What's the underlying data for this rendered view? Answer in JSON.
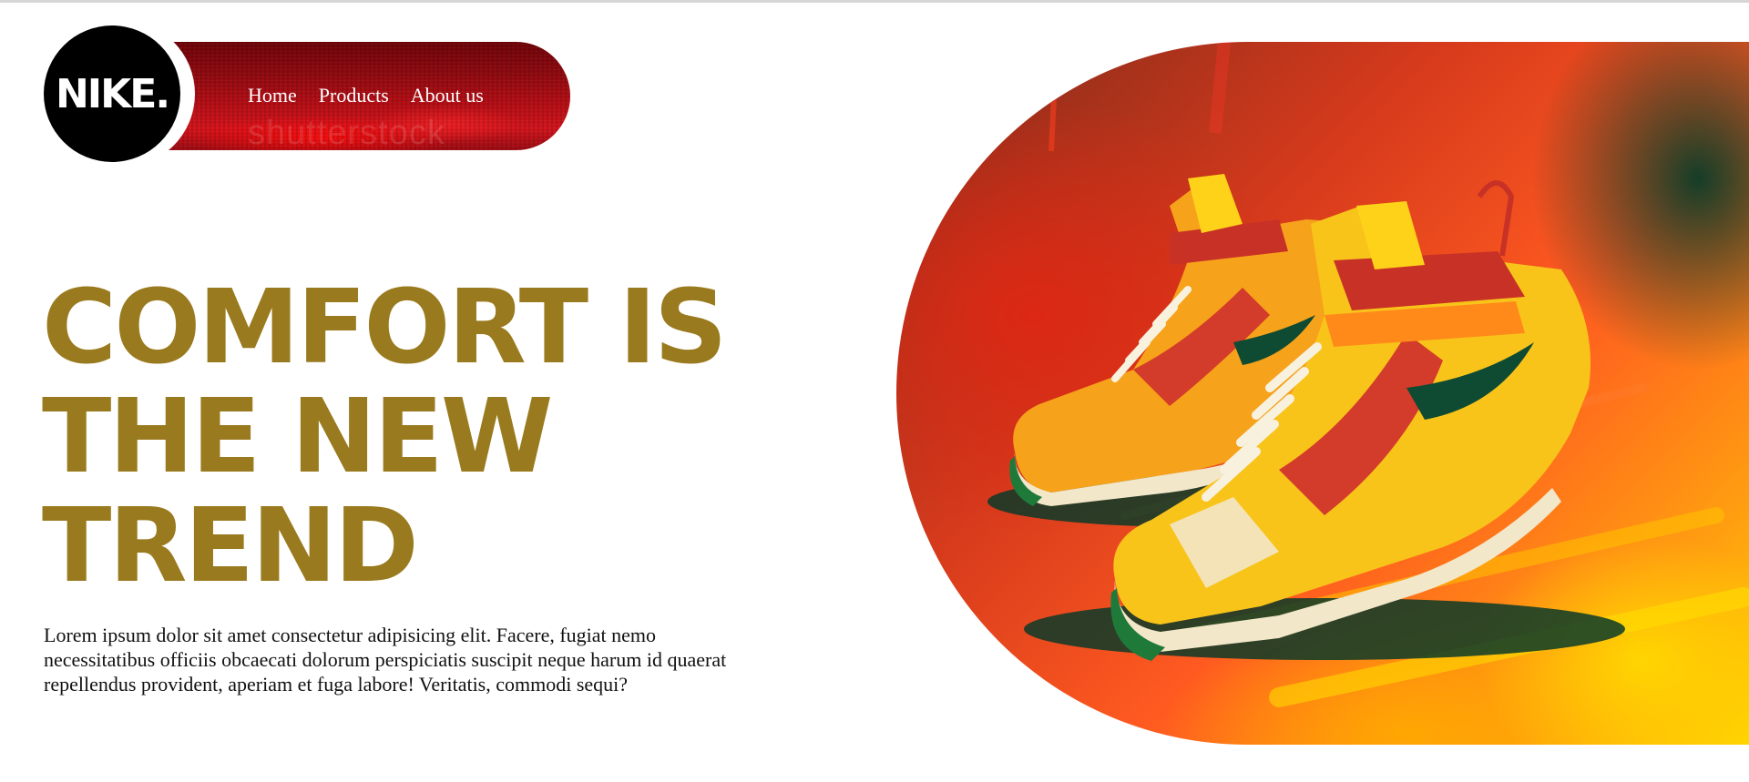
{
  "brand": {
    "logo_text": "NIKE."
  },
  "nav": {
    "links": [
      {
        "label": "Home"
      },
      {
        "label": "Products"
      },
      {
        "label": "About us"
      }
    ],
    "watermark": "shutterstock"
  },
  "hero": {
    "title": "COMFORT IS THE NEW TREND",
    "text": "Lorem ipsum dolor sit amet consectetur adipisicing elit. Facere, fugiat nemo necessitatibus officiis obcaecati dolorum perspiciatis suscipit neque harum id quaerat repellendus provident, aperiam et fuga labore! Veritatis, commodi sequi?"
  },
  "colors": {
    "title": "#9a7a1e",
    "nav_bg": "#b10d14",
    "logo_bg": "#000000"
  }
}
